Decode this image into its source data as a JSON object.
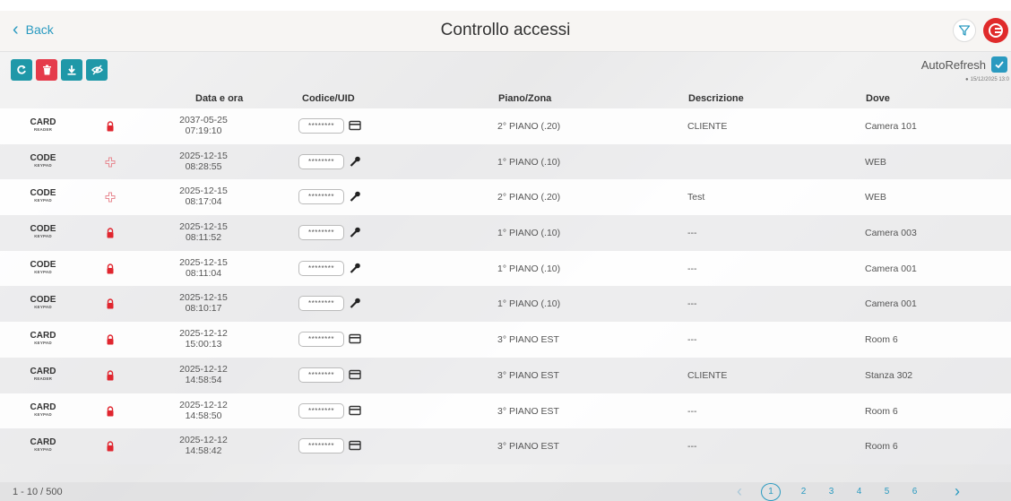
{
  "header": {
    "back_label": "Back",
    "title": "Controllo accessi"
  },
  "toolbar": {
    "buttons": [
      "refresh-icon",
      "trash-icon",
      "download-icon",
      "eye-off-icon"
    ]
  },
  "autorefresh": {
    "label": "AutoRefresh",
    "checked": true,
    "updated": "15/12/2025 13:0"
  },
  "table": {
    "columns": [
      "Data e ora",
      "Codice/UID",
      "Piano/Zona",
      "Descrizione",
      "Dove"
    ],
    "rows": [
      {
        "type": "CARD",
        "sub": "READER",
        "status": "lock-icon",
        "date": "2037-05-25",
        "time": "07:19:10",
        "code": "********",
        "cred": "card-icon",
        "piano": "2° PIANO (.20)",
        "desc": "CLIENTE",
        "dove": "Camera 101"
      },
      {
        "type": "CODE",
        "sub": "KEYPAD",
        "status": "puzzle-icon",
        "date": "2025-12-15",
        "time": "08:28:55",
        "code": "********",
        "cred": "key-icon",
        "piano": "1° PIANO (.10)",
        "desc": "",
        "dove": "WEB"
      },
      {
        "type": "CODE",
        "sub": "KEYPAD",
        "status": "puzzle-icon",
        "date": "2025-12-15",
        "time": "08:17:04",
        "code": "********",
        "cred": "key-icon",
        "piano": "2° PIANO (.20)",
        "desc": "Test",
        "dove": "WEB"
      },
      {
        "type": "CODE",
        "sub": "KEYPAD",
        "status": "lock-icon",
        "date": "2025-12-15",
        "time": "08:11:52",
        "code": "********",
        "cred": "key-icon",
        "piano": "1° PIANO (.10)",
        "desc": "---",
        "dove": "Camera 003"
      },
      {
        "type": "CODE",
        "sub": "KEYPAD",
        "status": "lock-icon",
        "date": "2025-12-15",
        "time": "08:11:04",
        "code": "********",
        "cred": "key-icon",
        "piano": "1° PIANO (.10)",
        "desc": "---",
        "dove": "Camera 001"
      },
      {
        "type": "CODE",
        "sub": "KEYPAD",
        "status": "lock-icon",
        "date": "2025-12-15",
        "time": "08:10:17",
        "code": "********",
        "cred": "key-icon",
        "piano": "1° PIANO (.10)",
        "desc": "---",
        "dove": "Camera 001"
      },
      {
        "type": "CARD",
        "sub": "KEYPAD",
        "status": "lock-icon",
        "date": "2025-12-12",
        "time": "15:00:13",
        "code": "********",
        "cred": "card-icon",
        "piano": "3° PIANO EST",
        "desc": "---",
        "dove": "Room 6"
      },
      {
        "type": "CARD",
        "sub": "READER",
        "status": "lock-icon",
        "date": "2025-12-12",
        "time": "14:58:54",
        "code": "********",
        "cred": "card-icon",
        "piano": "3° PIANO EST",
        "desc": "CLIENTE",
        "dove": "Stanza 302"
      },
      {
        "type": "CARD",
        "sub": "KEYPAD",
        "status": "lock-icon",
        "date": "2025-12-12",
        "time": "14:58:50",
        "code": "********",
        "cred": "card-icon",
        "piano": "3° PIANO EST",
        "desc": "---",
        "dove": "Room 6"
      },
      {
        "type": "CARD",
        "sub": "KEYPAD",
        "status": "lock-icon",
        "date": "2025-12-12",
        "time": "14:58:42",
        "code": "********",
        "cred": "card-icon",
        "piano": "3° PIANO EST",
        "desc": "---",
        "dove": "Room 6"
      }
    ]
  },
  "footer": {
    "count": "1 - 10 / 500",
    "pages": [
      "1",
      "2",
      "3",
      "4",
      "5",
      "6"
    ],
    "current_page": "1"
  },
  "colors": {
    "accent": "#2a9ac0",
    "toolbar_teal": "#1f98a8",
    "danger": "#e53b4b",
    "lock": "#e0262f"
  }
}
